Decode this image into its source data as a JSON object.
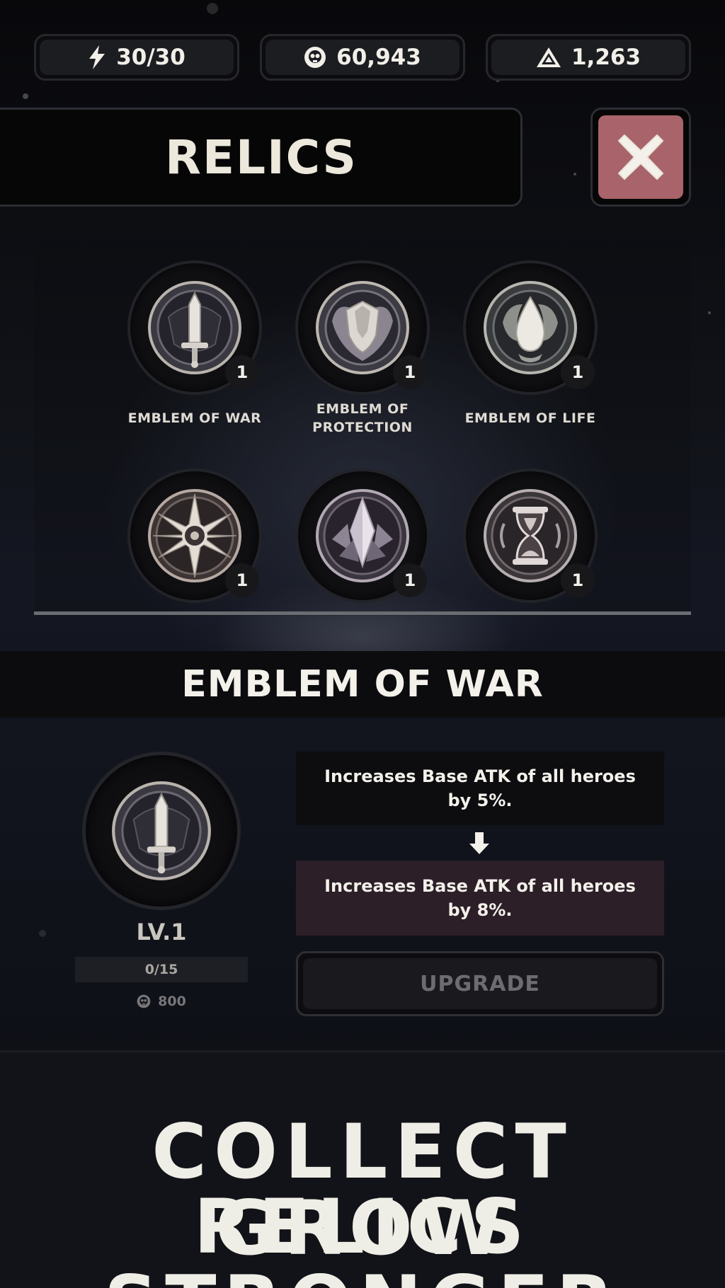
{
  "resources": [
    {
      "icon": "lightning-icon",
      "value": "30/30"
    },
    {
      "icon": "skull-coin-icon",
      "value": "60,943"
    },
    {
      "icon": "crystal-triangle-icon",
      "value": "1,263"
    }
  ],
  "header": {
    "title": "RELICS",
    "close_icon": "close-icon"
  },
  "relics": [
    {
      "name": "EMBLEM OF WAR",
      "count": "1",
      "icon": "sword-emblem-icon"
    },
    {
      "name": "EMBLEM OF PROTECTION",
      "name_lines": [
        "EMBLEM OF",
        "PROTECTION"
      ],
      "count": "1",
      "icon": "shield-emblem-icon"
    },
    {
      "name": "EMBLEM OF LIFE",
      "count": "1",
      "icon": "droplet-emblem-icon"
    },
    {
      "name": "",
      "count": "1",
      "icon": "star-emblem-icon"
    },
    {
      "name": "",
      "count": "1",
      "icon": "crystal-emblem-icon"
    },
    {
      "name": "",
      "count": "1",
      "icon": "hourglass-emblem-icon"
    }
  ],
  "detail": {
    "title": "EMBLEM OF WAR",
    "level": "LV.1",
    "progress_text": "0/15",
    "progress_fraction": 0,
    "cost": "800",
    "current_effect": "Increases Base ATK of all heroes by 5%.",
    "next_effect": "Increases Base ATK of all heroes by 8%.",
    "upgrade_label": "UPGRADE"
  },
  "tagline": {
    "line1": "COLLECT RELICS",
    "line2": "GROW STRONGER"
  },
  "colors": {
    "close_button": "#a8646a",
    "next_effect_bg": "#2c1f28",
    "text_light": "#ece9df"
  }
}
